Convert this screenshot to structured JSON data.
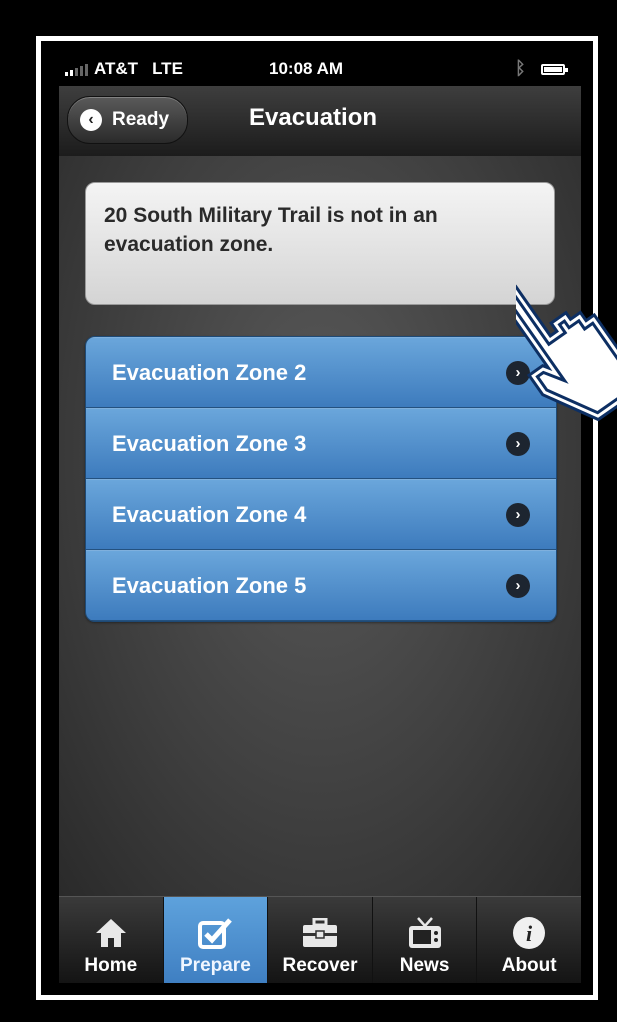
{
  "status": {
    "carrier": "AT&T",
    "network": "LTE",
    "time": "10:08 AM"
  },
  "nav": {
    "back_label": "Ready",
    "title": "Evacuation"
  },
  "notice": {
    "text": "20 South Military Trail is not in an evacuation zone."
  },
  "zones": [
    {
      "label": "Evacuation Zone 2"
    },
    {
      "label": "Evacuation Zone 3"
    },
    {
      "label": "Evacuation Zone 4"
    },
    {
      "label": "Evacuation Zone 5"
    }
  ],
  "tabs": [
    {
      "label": "Home",
      "icon": "home-icon"
    },
    {
      "label": "Prepare",
      "icon": "checkbox-icon",
      "active": true
    },
    {
      "label": "Recover",
      "icon": "toolbox-icon"
    },
    {
      "label": "News",
      "icon": "tv-icon"
    },
    {
      "label": "About",
      "icon": "info-icon"
    }
  ],
  "colors": {
    "accent": "#4a8ccc",
    "navbar": "#2a2a2a",
    "background": "#000000"
  }
}
